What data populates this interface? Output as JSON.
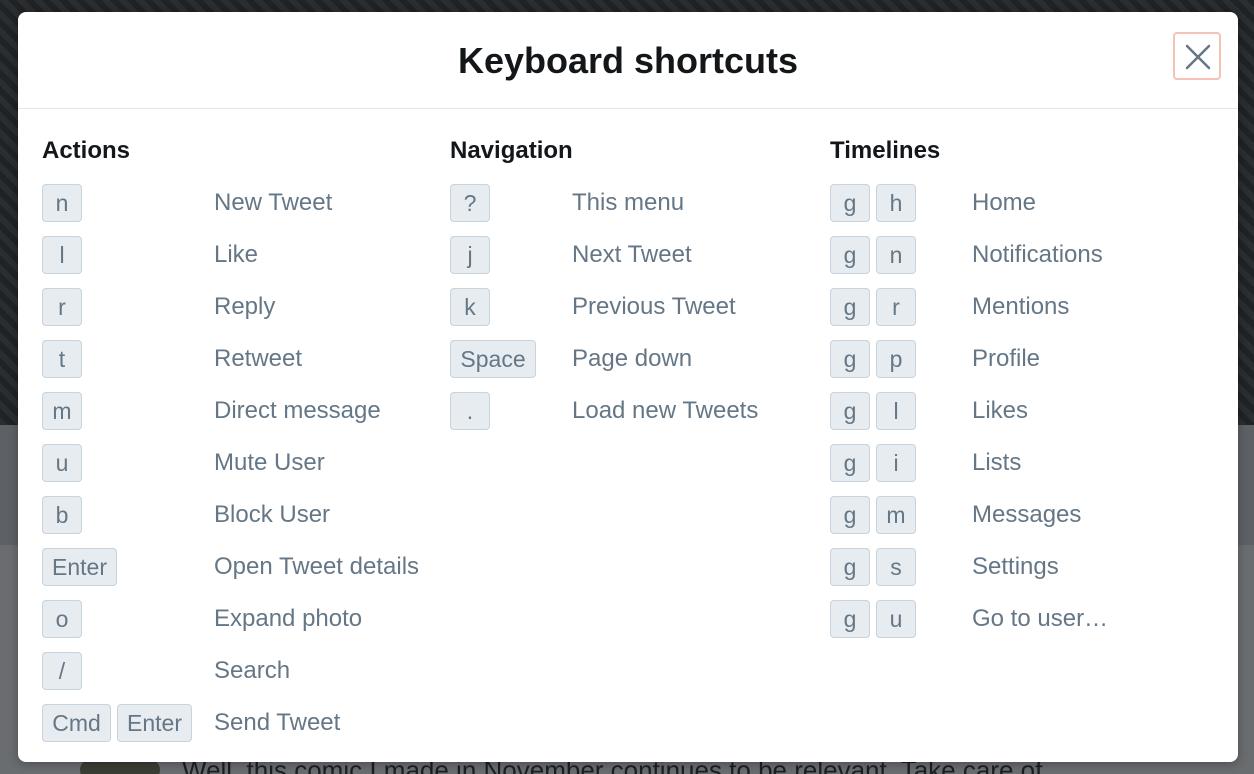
{
  "background": {
    "tweet_text": "Well, this comic I made in November continues to be relevant. Take care of"
  },
  "modal": {
    "title": "Keyboard shortcuts",
    "close_icon": "close-icon"
  },
  "columns": {
    "actions": {
      "heading": "Actions",
      "items": [
        {
          "keys": [
            "n"
          ],
          "label": "New Tweet"
        },
        {
          "keys": [
            "l"
          ],
          "label": "Like"
        },
        {
          "keys": [
            "r"
          ],
          "label": "Reply"
        },
        {
          "keys": [
            "t"
          ],
          "label": "Retweet"
        },
        {
          "keys": [
            "m"
          ],
          "label": "Direct message"
        },
        {
          "keys": [
            "u"
          ],
          "label": "Mute User"
        },
        {
          "keys": [
            "b"
          ],
          "label": "Block User"
        },
        {
          "keys": [
            "Enter"
          ],
          "label": "Open Tweet details"
        },
        {
          "keys": [
            "o"
          ],
          "label": "Expand photo"
        },
        {
          "keys": [
            "/"
          ],
          "label": "Search"
        },
        {
          "keys": [
            "Cmd",
            "Enter"
          ],
          "label": "Send Tweet"
        }
      ]
    },
    "navigation": {
      "heading": "Navigation",
      "items": [
        {
          "keys": [
            "?"
          ],
          "label": "This menu"
        },
        {
          "keys": [
            "j"
          ],
          "label": "Next Tweet"
        },
        {
          "keys": [
            "k"
          ],
          "label": "Previous Tweet"
        },
        {
          "keys": [
            "Space"
          ],
          "label": "Page down"
        },
        {
          "keys": [
            "."
          ],
          "label": "Load new Tweets"
        }
      ]
    },
    "timelines": {
      "heading": "Timelines",
      "items": [
        {
          "keys": [
            "g",
            "h"
          ],
          "label": "Home"
        },
        {
          "keys": [
            "g",
            "n"
          ],
          "label": "Notifications"
        },
        {
          "keys": [
            "g",
            "r"
          ],
          "label": "Mentions"
        },
        {
          "keys": [
            "g",
            "p"
          ],
          "label": "Profile"
        },
        {
          "keys": [
            "g",
            "l"
          ],
          "label": "Likes"
        },
        {
          "keys": [
            "g",
            "i"
          ],
          "label": "Lists"
        },
        {
          "keys": [
            "g",
            "m"
          ],
          "label": "Messages"
        },
        {
          "keys": [
            "g",
            "s"
          ],
          "label": "Settings"
        },
        {
          "keys": [
            "g",
            "u"
          ],
          "label": "Go to user…"
        }
      ]
    }
  },
  "colors": {
    "key_bg": "#e6ecf0",
    "key_border": "#c8d3dc",
    "text_secondary": "#657786",
    "text_primary": "#14171a",
    "close_focus_ring": "#f4c3b6"
  }
}
